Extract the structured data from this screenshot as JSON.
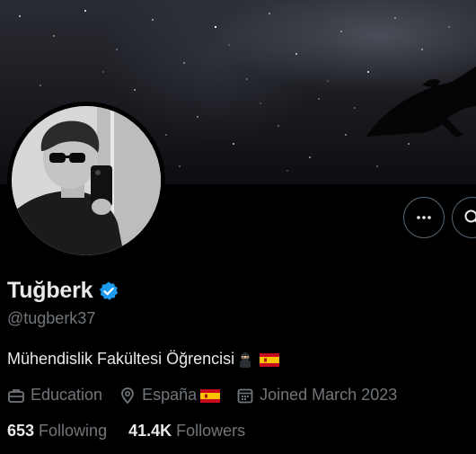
{
  "profile": {
    "display_name": "Tuğberk",
    "handle": "@tugberk37",
    "bio": "Mühendislik Fakültesi Öğrencisi",
    "bio_emojis": [
      "ninja-emoji",
      "spain-flag"
    ],
    "category": "Education",
    "location": "España",
    "joined": "Joined March 2023",
    "following_count": "653",
    "following_label": "Following",
    "followers_count": "41.4K",
    "followers_label": "Followers"
  },
  "icons": {
    "verified": "verified-badge-icon",
    "more": "more-icon",
    "search": "search-icon",
    "category": "briefcase-icon",
    "location": "location-pin-icon",
    "joined": "calendar-icon"
  },
  "colors": {
    "background": "#000000",
    "text": "#e7e9ea",
    "muted": "#71767b",
    "verified": "#1d9bf0",
    "border": "#536471"
  }
}
